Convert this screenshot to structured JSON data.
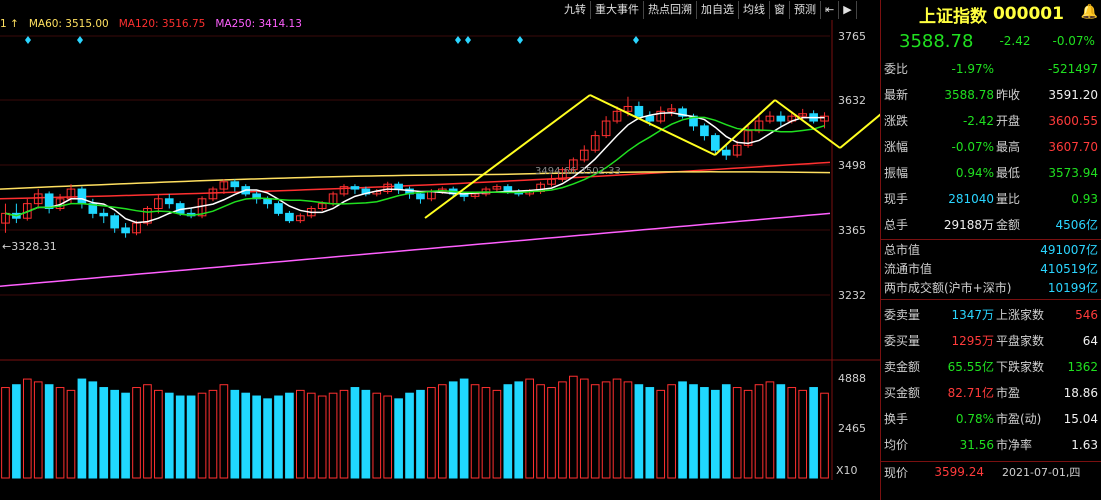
{
  "toolbar": [
    "九转",
    "重大事件",
    "热点回溯",
    "加自选",
    "均线",
    "窗",
    "预测",
    "⇤",
    "▶"
  ],
  "ma_legend": [
    {
      "label": "MA60: 3515.00",
      "color": "#ffe060"
    },
    {
      "label": "MA120: 3516.75",
      "color": "#ff3030"
    },
    {
      "label": "MA250: 3414.13",
      "color": "#ff60ff"
    }
  ],
  "ma_legend_prefix": "1 ↑",
  "price_axis": [
    "3765",
    "3632",
    "3498",
    "3365",
    "3232"
  ],
  "volume_axis": [
    "4888",
    "2465",
    "X10"
  ],
  "chart_labels": {
    "low_marker": "←3328.31",
    "mid_marker": "3494.66    3502.33"
  },
  "colors": {
    "up": "#ff3030",
    "down": "#20d8ff",
    "bg": "#000000",
    "grid": "#7a1010",
    "accent": "#ffff20"
  },
  "panel": {
    "title": "上证指数",
    "code": "000001",
    "price": "3588.78",
    "change": "-2.42",
    "change_pct": "-0.07%",
    "rows": [
      {
        "l1": "委比",
        "v1": "-1.97%",
        "c1": "green",
        "l2": "",
        "v2": "-521497",
        "c2": "green"
      },
      {
        "l1": "最新",
        "v1": "3588.78",
        "c1": "green",
        "l2": "昨收",
        "v2": "3591.20",
        "c2": "white"
      },
      {
        "l1": "涨跌",
        "v1": "-2.42",
        "c1": "green",
        "l2": "开盘",
        "v2": "3600.55",
        "c2": "red"
      },
      {
        "l1": "涨幅",
        "v1": "-0.07%",
        "c1": "green",
        "l2": "最高",
        "v2": "3607.70",
        "c2": "red"
      },
      {
        "l1": "振幅",
        "v1": "0.94%",
        "c1": "green",
        "l2": "最低",
        "v2": "3573.94",
        "c2": "green"
      },
      {
        "l1": "现手",
        "v1": "281040",
        "c1": "cyan",
        "l2": "量比",
        "v2": "0.93",
        "c2": "green"
      },
      {
        "l1": "总手",
        "v1": "29188万",
        "c1": "white",
        "l2": "金额",
        "v2": "4506亿",
        "c2": "cyan"
      }
    ],
    "rows2": [
      {
        "l": "总市值",
        "v": "491007亿",
        "c": "cyan"
      },
      {
        "l": "流通市值",
        "v": "410519亿",
        "c": "cyan"
      },
      {
        "l": "两市成交额(沪市+深市)",
        "v": "10199亿",
        "c": "cyan"
      }
    ],
    "rows3": [
      {
        "l1": "委卖量",
        "v1": "1347万",
        "c1": "cyan",
        "l2": "上涨家数",
        "v2": "546",
        "c2": "red"
      },
      {
        "l1": "委买量",
        "v1": "1295万",
        "c1": "red",
        "l2": "平盘家数",
        "v2": "64",
        "c2": "white"
      },
      {
        "l1": "卖金额",
        "v1": "65.55亿",
        "c1": "green",
        "l2": "下跌家数",
        "v2": "1362",
        "c2": "green"
      },
      {
        "l1": "买金额",
        "v1": "82.71亿",
        "c1": "red",
        "l2": "市盈",
        "v2": "18.86",
        "c2": "white"
      },
      {
        "l1": "换手",
        "v1": "0.78%",
        "c1": "green",
        "l2": "市盈(动)",
        "v2": "15.04",
        "c2": "white"
      },
      {
        "l1": "均价",
        "v1": "31.56",
        "c1": "green",
        "l2": "市净率",
        "v2": "1.63",
        "c2": "white"
      }
    ],
    "footer_label": "现价",
    "footer_price": "3599.24",
    "footer_time": "2021-07-01,四"
  },
  "chart_data": {
    "type": "candlestick",
    "price_range": [
      3232,
      3800
    ],
    "volume_range": [
      0,
      6000
    ],
    "candles": [
      [
        3380,
        3400,
        3360,
        3420
      ],
      [
        3400,
        3390,
        3380,
        3420
      ],
      [
        3390,
        3420,
        3385,
        3430
      ],
      [
        3420,
        3440,
        3410,
        3450
      ],
      [
        3440,
        3410,
        3400,
        3445
      ],
      [
        3410,
        3430,
        3405,
        3440
      ],
      [
        3430,
        3450,
        3420,
        3460
      ],
      [
        3450,
        3420,
        3410,
        3455
      ],
      [
        3420,
        3400,
        3390,
        3430
      ],
      [
        3400,
        3395,
        3380,
        3410
      ],
      [
        3395,
        3370,
        3360,
        3400
      ],
      [
        3370,
        3360,
        3350,
        3380
      ],
      [
        3360,
        3380,
        3355,
        3385
      ],
      [
        3380,
        3410,
        3375,
        3415
      ],
      [
        3410,
        3430,
        3400,
        3440
      ],
      [
        3430,
        3420,
        3410,
        3440
      ],
      [
        3420,
        3400,
        3395,
        3425
      ],
      [
        3400,
        3395,
        3390,
        3410
      ],
      [
        3395,
        3430,
        3390,
        3435
      ],
      [
        3430,
        3450,
        3425,
        3455
      ],
      [
        3450,
        3465,
        3440,
        3470
      ],
      [
        3465,
        3455,
        3445,
        3470
      ],
      [
        3455,
        3440,
        3435,
        3460
      ],
      [
        3440,
        3430,
        3420,
        3445
      ],
      [
        3430,
        3420,
        3410,
        3435
      ],
      [
        3420,
        3400,
        3395,
        3425
      ],
      [
        3400,
        3385,
        3380,
        3405
      ],
      [
        3385,
        3395,
        3380,
        3400
      ],
      [
        3395,
        3410,
        3390,
        3415
      ],
      [
        3410,
        3420,
        3405,
        3425
      ],
      [
        3420,
        3440,
        3415,
        3445
      ],
      [
        3440,
        3455,
        3435,
        3460
      ],
      [
        3455,
        3450,
        3440,
        3460
      ],
      [
        3450,
        3440,
        3435,
        3455
      ],
      [
        3440,
        3445,
        3435,
        3450
      ],
      [
        3445,
        3460,
        3440,
        3465
      ],
      [
        3460,
        3450,
        3440,
        3465
      ],
      [
        3450,
        3440,
        3430,
        3455
      ],
      [
        3440,
        3430,
        3420,
        3445
      ],
      [
        3430,
        3445,
        3425,
        3450
      ],
      [
        3445,
        3450,
        3440,
        3455
      ],
      [
        3450,
        3440,
        3435,
        3455
      ],
      [
        3440,
        3435,
        3425,
        3445
      ],
      [
        3435,
        3440,
        3430,
        3445
      ],
      [
        3440,
        3450,
        3435,
        3455
      ],
      [
        3450,
        3455,
        3445,
        3460
      ],
      [
        3455,
        3445,
        3440,
        3460
      ],
      [
        3445,
        3440,
        3435,
        3450
      ],
      [
        3440,
        3445,
        3435,
        3450
      ],
      [
        3445,
        3460,
        3440,
        3465
      ],
      [
        3460,
        3470,
        3455,
        3480
      ],
      [
        3470,
        3490,
        3465,
        3495
      ],
      [
        3490,
        3510,
        3485,
        3515
      ],
      [
        3510,
        3530,
        3505,
        3540
      ],
      [
        3530,
        3560,
        3525,
        3570
      ],
      [
        3560,
        3590,
        3555,
        3600
      ],
      [
        3590,
        3610,
        3585,
        3620
      ],
      [
        3610,
        3620,
        3600,
        3640
      ],
      [
        3620,
        3600,
        3595,
        3630
      ],
      [
        3600,
        3590,
        3580,
        3610
      ],
      [
        3590,
        3610,
        3585,
        3620
      ],
      [
        3610,
        3615,
        3600,
        3625
      ],
      [
        3615,
        3600,
        3595,
        3620
      ],
      [
        3600,
        3580,
        3570,
        3605
      ],
      [
        3580,
        3560,
        3550,
        3585
      ],
      [
        3560,
        3530,
        3520,
        3565
      ],
      [
        3530,
        3520,
        3510,
        3540
      ],
      [
        3520,
        3540,
        3515,
        3550
      ],
      [
        3540,
        3570,
        3535,
        3580
      ],
      [
        3570,
        3590,
        3565,
        3600
      ],
      [
        3590,
        3600,
        3585,
        3610
      ],
      [
        3600,
        3590,
        3580,
        3610
      ],
      [
        3590,
        3600,
        3585,
        3610
      ],
      [
        3600,
        3605,
        3590,
        3615
      ],
      [
        3605,
        3590,
        3585,
        3612
      ],
      [
        3590,
        3600,
        3575,
        3608
      ]
    ],
    "volumes": [
      3200,
      3300,
      3500,
      3400,
      3300,
      3200,
      3100,
      3500,
      3400,
      3200,
      3100,
      3000,
      3200,
      3300,
      3100,
      3000,
      2900,
      2900,
      3000,
      3100,
      3300,
      3100,
      3000,
      2900,
      2800,
      2900,
      3000,
      3100,
      3000,
      2900,
      3000,
      3100,
      3200,
      3100,
      3000,
      2900,
      2800,
      3000,
      3100,
      3200,
      3300,
      3400,
      3500,
      3300,
      3200,
      3100,
      3300,
      3400,
      3500,
      3300,
      3200,
      3400,
      3600,
      3500,
      3300,
      3400,
      3500,
      3400,
      3300,
      3200,
      3100,
      3300,
      3400,
      3300,
      3200,
      3100,
      3300,
      3200,
      3100,
      3300,
      3400,
      3300,
      3200,
      3100,
      3200,
      3000
    ]
  }
}
